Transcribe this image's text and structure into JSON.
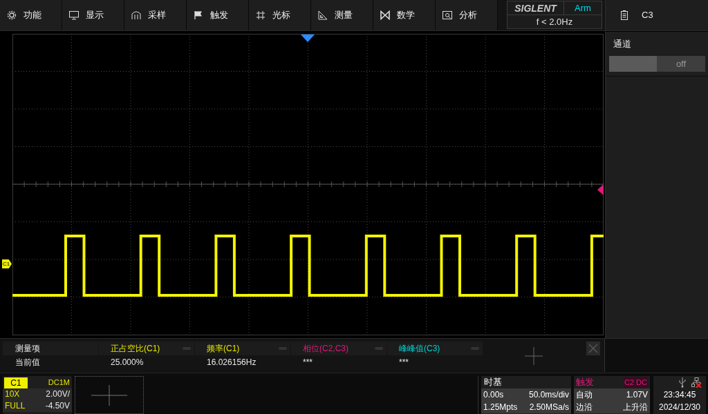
{
  "menu": [
    {
      "label": "功能"
    },
    {
      "label": "显示"
    },
    {
      "label": "采样"
    },
    {
      "label": "触发"
    },
    {
      "label": "光标"
    },
    {
      "label": "测量"
    },
    {
      "label": "数学"
    },
    {
      "label": "分析"
    }
  ],
  "brand": {
    "logo": "SIGLENT",
    "trigger_state": "Arm",
    "frequency": "f < 2.0Hz"
  },
  "channel_panel": {
    "title": "C3",
    "setting": "通道",
    "toggle": {
      "label": "off",
      "on": false
    }
  },
  "trace": {
    "marker": "C1"
  },
  "measurements": {
    "row_header": "测量项",
    "value_header": "当前值",
    "items": [
      {
        "name": "正占空比(C1)",
        "value": "25.000%",
        "color": "#e6e600"
      },
      {
        "name": "频率(C1)",
        "value": "16.026156Hz",
        "color": "#e6e600"
      },
      {
        "name": "相位(C2,C3)",
        "value": "***",
        "color": "#e0187a"
      },
      {
        "name": "峰峰值(C3)",
        "value": "***",
        "color": "#00d0d0"
      }
    ]
  },
  "channel_box": {
    "name": "C1",
    "coupling": "DC1M",
    "probe": "10X",
    "scale": "2.00V/",
    "bandwidth": "FULL",
    "offset": "-4.50V"
  },
  "timebase": {
    "title": "时基",
    "delay": "0.00s",
    "scale": "50.0ms/div",
    "memory": "1.25Mpts",
    "sample_rate": "2.50MSa/s"
  },
  "trigger": {
    "title": "触发",
    "source": "C2",
    "coupling": "DC",
    "mode": "自动",
    "level": "1.07V",
    "type": "边沿",
    "slope": "上升沿"
  },
  "clock": {
    "time": "23:34:45",
    "date": "2024/12/30"
  }
}
